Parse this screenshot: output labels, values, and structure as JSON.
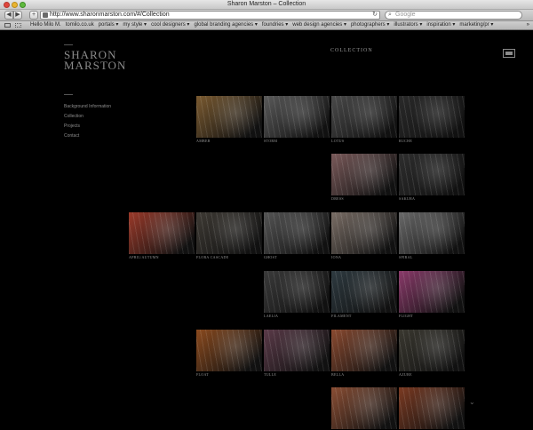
{
  "window": {
    "title": "Sharon Marston – Collection"
  },
  "toolbar": {
    "back_symbol": "◀",
    "forward_symbol": "▶",
    "add_symbol": "+",
    "url": "http://www.sharonmarston.com/#/Collection",
    "reload_symbol": "↻",
    "search_placeholder": "Google",
    "search_symbol": "⌕"
  },
  "bookmarks": {
    "items": [
      "Hello Milo M.",
      "tomilo.co.uk",
      "portals ▾",
      "my style ▾",
      "cool designers ▾",
      "global branding agencies ▾",
      "foundries ▾",
      "web design agencies ▾",
      "photographers ▾",
      "illustrators ▾",
      "inspiration ▾",
      "marketing/pr ▾"
    ],
    "more_symbol": "»"
  },
  "site": {
    "logo_line1": "SHARON",
    "logo_line2": "MARSTON",
    "nav": [
      "Background Information",
      "Collection",
      "Projects",
      "Contact"
    ],
    "section_title": "COLLECTION",
    "scroll_symbol": "⌄"
  },
  "tiles": [
    {
      "name": "AMBER",
      "color": "#7a5a30"
    },
    {
      "name": "STORM",
      "color": "#5a5a5a"
    },
    {
      "name": "LOTUS",
      "color": "#4a4a4a"
    },
    {
      "name": "RUCHE",
      "color": "#2a2a2a"
    },
    {
      "name": "DRESS",
      "color": "#7a5a5a"
    },
    {
      "name": "SAKURA",
      "color": "#2e2e2e"
    },
    {
      "name": "APRIL/AUTUMN",
      "color": "#9a3a2a"
    },
    {
      "name": "FLORA CASCADE",
      "color": "#3e3a34"
    },
    {
      "name": "GHOST",
      "color": "#555555"
    },
    {
      "name": "IONA",
      "color": "#7a6e66"
    },
    {
      "name": "SPIRAL",
      "color": "#6a6a6a"
    },
    {
      "name": "LAELIA",
      "color": "#3a3a3a"
    },
    {
      "name": "FILAMENT",
      "color": "#2e3a40"
    },
    {
      "name": "FLIGHT",
      "color": "#8a3a6a"
    },
    {
      "name": "FLOAT",
      "color": "#8a4a1e"
    },
    {
      "name": "TULLE",
      "color": "#5a3a48"
    },
    {
      "name": "BELLA",
      "color": "#8a4a30"
    },
    {
      "name": "AZURE",
      "color": "#3a3830"
    },
    {
      "name": "",
      "color": "#8a4e34"
    },
    {
      "name": "",
      "color": "#7a3a22"
    }
  ]
}
